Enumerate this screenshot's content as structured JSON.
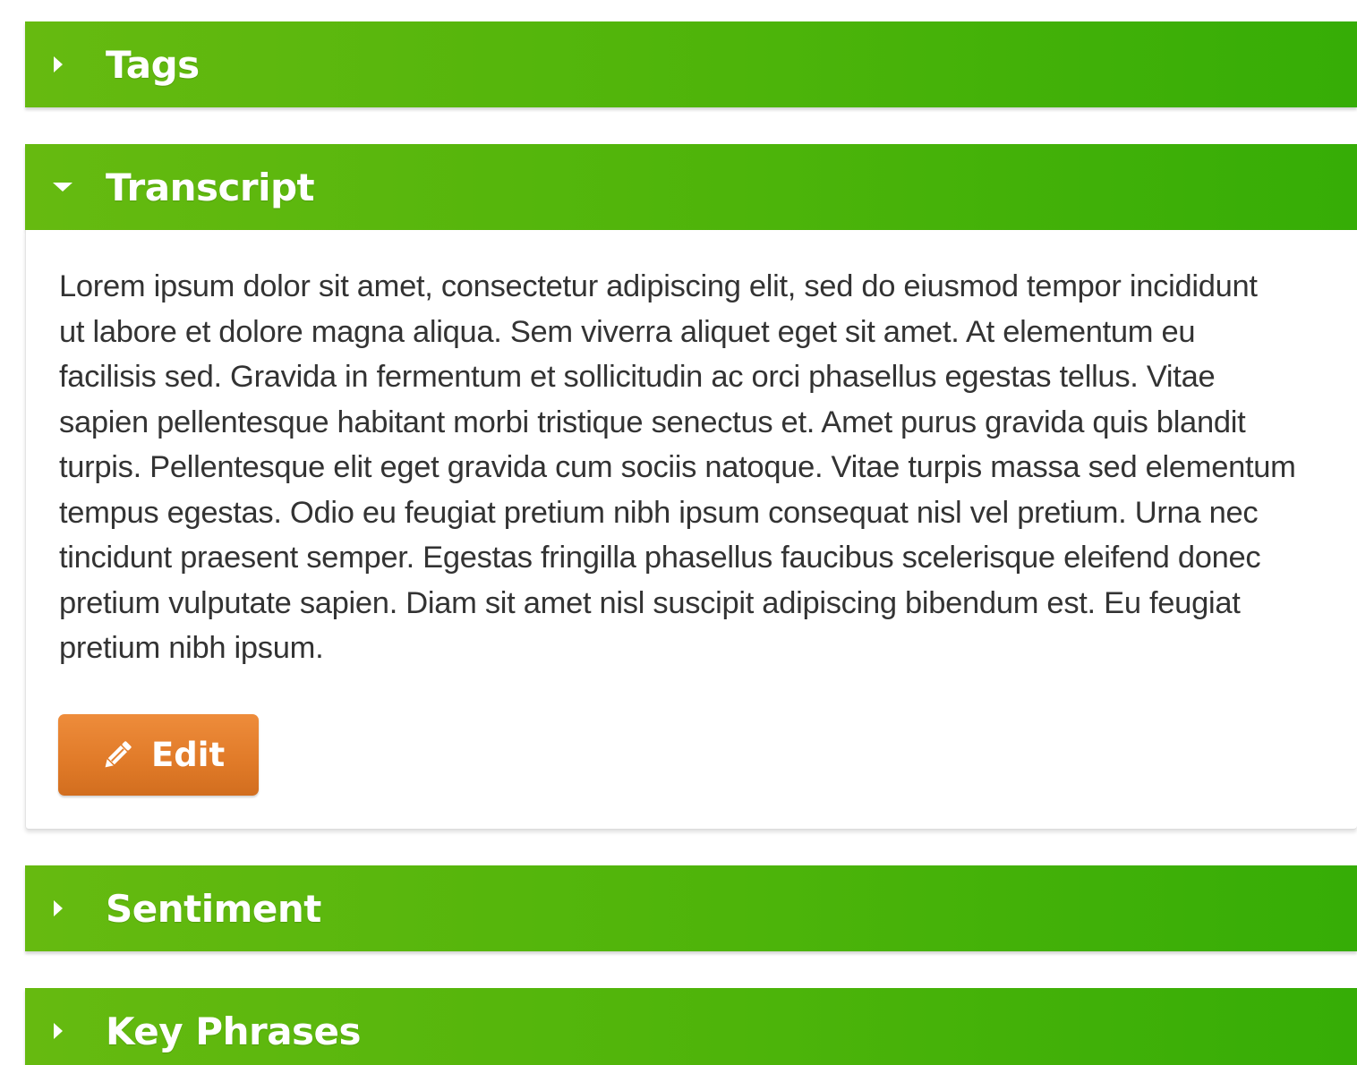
{
  "accordion": {
    "tags": {
      "title": "Tags",
      "expanded": false,
      "icon": "caret-right-icon"
    },
    "transcript": {
      "title": "Transcript",
      "expanded": true,
      "icon": "caret-down-icon",
      "lines": [
        "Lorem ipsum dolor sit amet, consectetur adipiscing elit, sed do eiusmod tempor incididunt",
        "ut labore et dolore magna aliqua. Sem viverra aliquet eget sit amet. At elementum eu",
        "facilisis sed. Gravida in fermentum et sollicitudin ac orci phasellus egestas tellus. Vitae",
        "sapien pellentesque habitant morbi tristique senectus et. Amet purus gravida quis blandit",
        "turpis. Pellentesque elit eget gravida cum sociis natoque. Vitae turpis massa sed elementum",
        "tempus egestas. Odio eu feugiat pretium nibh ipsum consequat nisl vel pretium. Urna nec",
        "tincidunt praesent semper. Egestas fringilla phasellus faucibus scelerisque eleifend donec",
        "pretium vulputate sapien. Diam sit amet nisl suscipit adipiscing bibendum est. Eu feugiat",
        "pretium nibh ipsum."
      ],
      "edit_label": "Edit",
      "edit_icon": "pencil-icon"
    },
    "sentiment": {
      "title": "Sentiment",
      "expanded": false,
      "icon": "caret-right-icon"
    },
    "key_phrases": {
      "title": "Key Phrases",
      "expanded": false,
      "icon": "caret-right-icon"
    }
  },
  "colors": {
    "header_green": "#4db40a",
    "edit_orange": "#e07a28",
    "text": "#333333"
  }
}
